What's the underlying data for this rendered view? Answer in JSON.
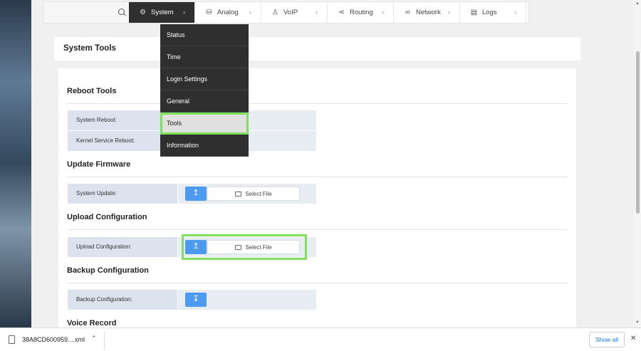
{
  "nav": {
    "items": [
      {
        "label": "System",
        "icon": "gear-icon"
      },
      {
        "label": "Analog",
        "icon": "database-icon"
      },
      {
        "label": "VoIP",
        "icon": "user-icon"
      },
      {
        "label": "Routing",
        "icon": "share-icon"
      },
      {
        "label": "Network",
        "icon": "link-icon"
      },
      {
        "label": "Logs",
        "icon": "book-icon"
      }
    ]
  },
  "system_menu": {
    "items": [
      "Status",
      "Time",
      "Login Settings",
      "General",
      "Tools",
      "Information"
    ],
    "selected": "Tools"
  },
  "page": {
    "title": "System Tools"
  },
  "sections": {
    "reboot": {
      "title": "Reboot Tools",
      "rows": [
        "System Reboot:",
        "Kernel Service Reboot:"
      ]
    },
    "firmware": {
      "title": "Update Firmware",
      "row_label": "System Update:",
      "select_label": "Select File"
    },
    "upload_config": {
      "title": "Upload Configuration",
      "row_label": "Upload Configuration:",
      "select_label": "Select File"
    },
    "backup_config": {
      "title": "Backup Configuration",
      "row_label": "Backup Configuration:"
    },
    "voice_record": {
      "title": "Voice Record"
    }
  },
  "download_bar": {
    "file_name": "38A8CD600959....xml",
    "show_all_label": "Show all"
  },
  "colors": {
    "accent": "#4d9bf0",
    "nav_active": "#2f2f2f",
    "highlight": "#7de05a",
    "label_bg": "#dde3ee"
  }
}
